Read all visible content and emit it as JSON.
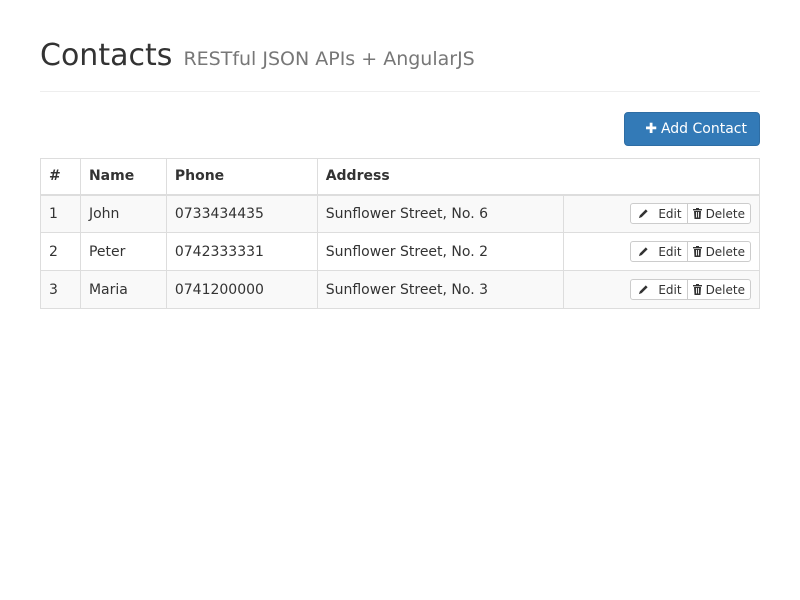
{
  "header": {
    "title": "Contacts",
    "subtitle": "RESTful JSON APIs + AngularJS"
  },
  "toolbar": {
    "add_label": "Add Contact",
    "add_icon": "plus-icon",
    "accent_color": "#337ab7"
  },
  "table": {
    "columns": [
      "#",
      "Name",
      "Phone",
      "Address",
      ""
    ],
    "rows": [
      {
        "id": "1",
        "name": "John",
        "phone": "0733434435",
        "address": "Sunflower Street, No. 6"
      },
      {
        "id": "2",
        "name": "Peter",
        "phone": "0742333331",
        "address": "Sunflower Street, No. 2"
      },
      {
        "id": "3",
        "name": "Maria",
        "phone": "0741200000",
        "address": "Sunflower Street, No. 3"
      }
    ],
    "row_actions": {
      "edit_label": "Edit",
      "edit_icon": "pencil-icon",
      "delete_label": "Delete",
      "delete_icon": "trash-icon"
    }
  }
}
